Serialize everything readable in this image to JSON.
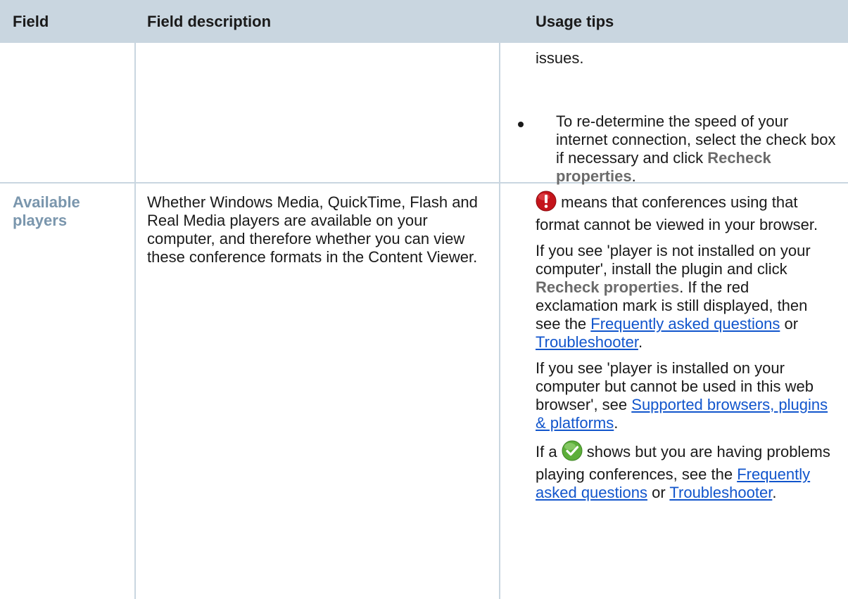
{
  "header": {
    "col1": "Field",
    "col2": "Field description",
    "col3": "Usage tips"
  },
  "row1": {
    "continued_text": "issues.",
    "bullet_text": "To re-determine the speed of your internet connection, select the check box if necessary and click ",
    "bullet_strong": "Recheck properties",
    "bullet_end": "."
  },
  "row2": {
    "field": "Available players",
    "description": "Whether Windows Media, QuickTime, Flash and Real Media players are available on your computer, and therefore whether you can view these conference formats in the Content Viewer.",
    "tip1_text": " means that conferences using that format cannot be viewed in your browser.",
    "tip2_a": "If you see 'player is not installed on your computer', install the plugin and click ",
    "tip2_strong": "Recheck properties",
    "tip2_b": ". If the red exclamation mark is still displayed, then see the ",
    "tip2_link1": "Frequently asked questions",
    "tip2_c": " or ",
    "tip2_link2": "Troubleshooter",
    "tip2_d": ".",
    "tip3_a": "If you see 'player is installed on your computer but cannot be used in this web browser', see ",
    "tip3_link": "Supported browsers, plugins & platforms",
    "tip3_b": ".",
    "tip4_a": "If a ",
    "tip4_b": " shows but you are having problems playing conferences, see the ",
    "tip4_link1": "Frequently asked questions",
    "tip4_c": " or ",
    "tip4_link2": "Troubleshooter",
    "tip4_d": "."
  },
  "icons": {
    "error": "exclamation-error-icon",
    "check": "checkmark-ok-icon"
  },
  "colors": {
    "header_bg": "#c9d6e0",
    "field_label": "#7a96ad",
    "link": "#1155cc"
  }
}
